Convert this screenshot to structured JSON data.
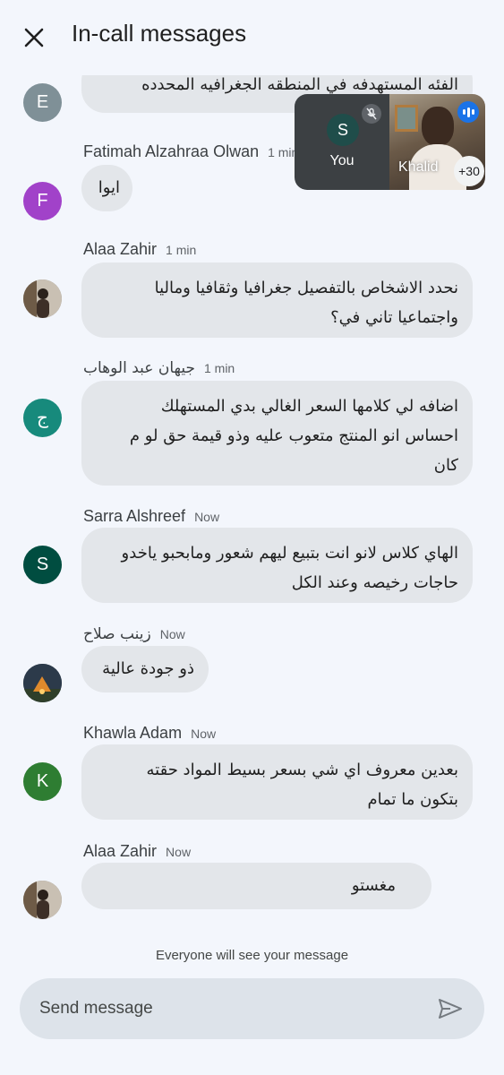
{
  "header": {
    "title": "In-call messages",
    "close_icon": "close-icon"
  },
  "pip": {
    "self": {
      "avatar_initial": "S",
      "name": "You",
      "mic_icon": "mic-off-icon"
    },
    "other": {
      "name": "Khalid",
      "more_count": "+30",
      "speaking_icon": "audio-level-icon"
    }
  },
  "messages": [
    {
      "sender": "",
      "time": "",
      "avatar_initial": "E",
      "avatar_color": "#7f9097",
      "lines": [
        "الفئه المستهدفه في المنطقه الجغرافيه المحدده"
      ]
    },
    {
      "sender": "Fatimah Alzahraa Olwan",
      "time": "1 min",
      "avatar_initial": "F",
      "avatar_color": "#a142c9",
      "lines": [
        "ايوا"
      ]
    },
    {
      "sender": "Alaa Zahir",
      "time": "1 min",
      "avatar_initial": "",
      "avatar_color": "#8c8a86",
      "lines": [
        "نحدد الاشخاص بالتفصيل جغرافيا وثقافيا وماليا",
        "واجتماعيا تاني في؟"
      ]
    },
    {
      "sender": "جيهان عبد الوهاب",
      "time": "1 min",
      "avatar_initial": "ج",
      "avatar_color": "#178a7c",
      "lines": [
        "اضافه لي كلامها السعر الغالي بدي المستهلك",
        "احساس انو المنتج متعوب عليه وذو قيمة حق لو م",
        "كان"
      ]
    },
    {
      "sender": "Sarra Alshreef",
      "time": "Now",
      "avatar_initial": "S",
      "avatar_color": "#004d40",
      "lines": [
        "الهاي كلاس لانو انت بتبيع ليهم شعور ومابحبو ياخدو",
        "حاجات رخيصه وعند الكل"
      ]
    },
    {
      "sender": "زينب صلاح",
      "time": "Now",
      "avatar_initial": "",
      "avatar_color": "#2c3a4a",
      "lines": [
        "ذو جودة عالية"
      ]
    },
    {
      "sender": "Khawla Adam",
      "time": "Now",
      "avatar_initial": "K",
      "avatar_color": "#2e7d32",
      "lines": [
        "بعدين معروف اي شي بسعر بسيط المواد حقته",
        "بتكون ما تمام"
      ]
    },
    {
      "sender": "Alaa Zahir",
      "time": "Now",
      "avatar_initial": "",
      "avatar_color": "#8c8a86",
      "lines": [
        "مغستو"
      ]
    }
  ],
  "footer": {
    "note": "Everyone will see your message",
    "input_placeholder": "Send message",
    "send_icon": "send-icon"
  }
}
